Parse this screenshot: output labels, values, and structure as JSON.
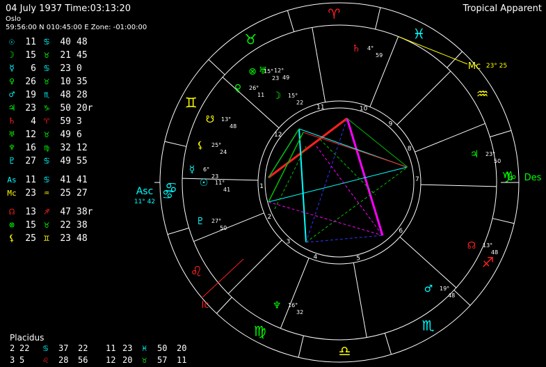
{
  "header": {
    "date_time": "04 July 1937  Time:03:13:20",
    "place": "Oslo",
    "coords": "59:56:00 N 010:45:00 E  Zone: -01:00:00",
    "mode": "Tropical Apparent"
  },
  "colors": {
    "fire": "#ff2020",
    "earth": "#00ff00",
    "air": "#ffff00",
    "water": "#00ffff",
    "white": "#ffffff",
    "magenta": "#ff00ff",
    "blue": "#3333ff",
    "green": "#00c000",
    "cyan": "#00dddd"
  },
  "planets": [
    {
      "symbol": "☉",
      "icon": "sun-icon",
      "deg": "11",
      "sign": "♋",
      "min": "40",
      "sec": "48",
      "color": "#00ffff"
    },
    {
      "symbol": "☽",
      "icon": "moon-icon",
      "deg": "15",
      "sign": "♉",
      "min": "21",
      "sec": "45",
      "color": "#00ff00"
    },
    {
      "symbol": "☿",
      "icon": "mercury-icon",
      "deg": "6",
      "sign": "♋",
      "min": "23",
      "sec": "0",
      "color": "#00ffff"
    },
    {
      "symbol": "♀",
      "icon": "venus-icon",
      "deg": "26",
      "sign": "♉",
      "min": "10",
      "sec": "35",
      "color": "#00ff00"
    },
    {
      "symbol": "♂",
      "icon": "mars-icon",
      "deg": "19",
      "sign": "♏",
      "min": "48",
      "sec": "28",
      "color": "#00ffff"
    },
    {
      "symbol": "♃",
      "icon": "jupiter-icon",
      "deg": "23",
      "sign": "♑",
      "min": "50",
      "sec": "20r",
      "color": "#00ff00"
    },
    {
      "symbol": "♄",
      "icon": "saturn-icon",
      "deg": "4",
      "sign": "♈",
      "min": "59",
      "sec": "3",
      "color": "#ff2020"
    },
    {
      "symbol": "♅",
      "icon": "uranus-icon",
      "deg": "12",
      "sign": "♉",
      "min": "49",
      "sec": "6",
      "color": "#00ff00"
    },
    {
      "symbol": "♆",
      "icon": "neptune-icon",
      "deg": "16",
      "sign": "♍",
      "min": "32",
      "sec": "12",
      "color": "#00ff00"
    },
    {
      "symbol": "♇",
      "icon": "pluto-icon",
      "deg": "27",
      "sign": "♋",
      "min": "49",
      "sec": "55",
      "color": "#00ffff"
    }
  ],
  "angles": [
    {
      "symbol": "As",
      "icon": "ascendant-label",
      "deg": "11",
      "sign": "♋",
      "min": "41",
      "sec": "41",
      "color": "#00ffff"
    },
    {
      "symbol": "Mc",
      "icon": "midheaven-label",
      "deg": "23",
      "sign": "♒",
      "min": "25",
      "sec": "27",
      "color": "#ffff00"
    }
  ],
  "points": [
    {
      "symbol": "☊",
      "icon": "north-node-icon",
      "deg": "13",
      "sign": "♐",
      "min": "47",
      "sec": "38r",
      "color": "#ff2020"
    },
    {
      "symbol": "⊗",
      "icon": "part-of-fortune-icon",
      "deg": "15",
      "sign": "♉",
      "min": "22",
      "sec": "38",
      "color": "#00ff00"
    },
    {
      "symbol": "⚸",
      "icon": "lilith-icon",
      "deg": "25",
      "sign": "♊",
      "min": "23",
      "sec": "48",
      "color": "#ffff00"
    }
  ],
  "cusps": {
    "title": "Placidus",
    "rows": [
      [
        "2",
        "22",
        "♋",
        "37",
        "22",
        "11",
        "23",
        "♓",
        "50",
        "20"
      ],
      [
        "3",
        "5",
        "♌",
        "28",
        "56",
        "12",
        "20",
        "♉",
        "57",
        "11"
      ]
    ]
  },
  "wheel": {
    "asc_label": "Asc",
    "asc_value": "11° 42",
    "des_label": "Des",
    "mc_label": "Mc",
    "mc_value": "23° 25",
    "ic_label": "Ic",
    "signs": [
      {
        "glyph": "♈",
        "name": "aries",
        "color": "#ff2020"
      },
      {
        "glyph": "♉",
        "name": "taurus",
        "color": "#00ff00"
      },
      {
        "glyph": "♊",
        "name": "gemini",
        "color": "#ffff00"
      },
      {
        "glyph": "♋",
        "name": "cancer",
        "color": "#00ffff"
      },
      {
        "glyph": "♌",
        "name": "leo",
        "color": "#ff2020"
      },
      {
        "glyph": "♍",
        "name": "virgo",
        "color": "#00ff00"
      },
      {
        "glyph": "♎",
        "name": "libra",
        "color": "#ffff00"
      },
      {
        "glyph": "♏",
        "name": "scorpio",
        "color": "#00ffff"
      },
      {
        "glyph": "♐",
        "name": "sagittarius",
        "color": "#ff2020"
      },
      {
        "glyph": "♑",
        "name": "capricorn",
        "color": "#00ff00"
      },
      {
        "glyph": "♒",
        "name": "aquarius",
        "color": "#ffff00"
      },
      {
        "glyph": "♓",
        "name": "pisces",
        "color": "#00ffff"
      }
    ],
    "house_numbers": [
      "1",
      "2",
      "3",
      "4",
      "5",
      "6",
      "7",
      "8",
      "9",
      "10",
      "11",
      "12"
    ],
    "planet_labels": [
      {
        "glyph": "♄",
        "name": "saturn",
        "color": "#ff2020",
        "deg": "4°",
        "min": "59"
      },
      {
        "glyph": "♅",
        "name": "uranus",
        "color": "#00ff00",
        "deg": "12°",
        "min": "49"
      },
      {
        "glyph": "⊗",
        "name": "part-of-fortune",
        "color": "#00ff00",
        "deg": "15°",
        "min": "23"
      },
      {
        "glyph": "♀",
        "name": "venus",
        "color": "#00ff00",
        "deg": "26°",
        "min": "11"
      },
      {
        "glyph": "☽",
        "name": "moon",
        "color": "#00ff00",
        "deg": "15°",
        "min": "22"
      },
      {
        "glyph": "☋",
        "name": "south-node",
        "color": "#ffff00",
        "deg": "13°",
        "min": "48"
      },
      {
        "glyph": "⚸",
        "name": "lilith",
        "color": "#ffff00",
        "deg": "25°",
        "min": "24"
      },
      {
        "glyph": "☿",
        "name": "mercury",
        "color": "#00ffff",
        "deg": "6°",
        "min": "23"
      },
      {
        "glyph": "☉",
        "name": "sun",
        "color": "#00ffff",
        "deg": "11°",
        "min": "41"
      },
      {
        "glyph": "♇",
        "name": "pluto",
        "color": "#00ffff",
        "deg": "27°",
        "min": "50"
      },
      {
        "glyph": "♃",
        "name": "jupiter",
        "color": "#00ff00",
        "deg": "23°",
        "min": "50"
      },
      {
        "glyph": "☊",
        "name": "north-node",
        "color": "#ff2020",
        "deg": "13°",
        "min": "48"
      },
      {
        "glyph": "♂",
        "name": "mars",
        "color": "#00ffff",
        "deg": "19°",
        "min": "48"
      },
      {
        "glyph": "♆",
        "name": "neptune",
        "color": "#00ff00",
        "deg": "16°",
        "min": "32"
      }
    ]
  }
}
